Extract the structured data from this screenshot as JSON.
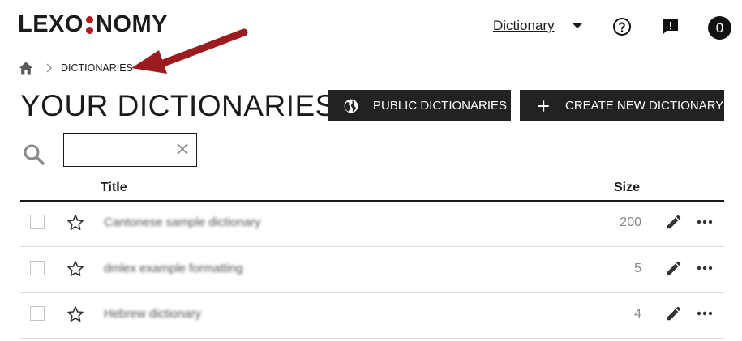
{
  "header": {
    "logo": {
      "left": "LEXO",
      "right": "NOMY"
    },
    "dictionary_menu_label": "Dictionary",
    "avatar_initial": "0"
  },
  "breadcrumb": {
    "current": "DICTIONARIES"
  },
  "page": {
    "title": "YOUR DICTIONARIES",
    "public_button": "PUBLIC DICTIONARIES",
    "create_button": "CREATE NEW DICTIONARY"
  },
  "search": {
    "value": "",
    "placeholder": ""
  },
  "table": {
    "columns": {
      "title": "Title",
      "size": "Size"
    },
    "rows": [
      {
        "title": "Cantonese sample dictionary",
        "size": "200"
      },
      {
        "title": "dmlex example formatting",
        "size": "5"
      },
      {
        "title": "Hebrew dictionary",
        "size": "4"
      }
    ]
  },
  "colors": {
    "accent": "#b01c22",
    "button_bg": "#222222",
    "arrow": "#9b1b1f"
  }
}
